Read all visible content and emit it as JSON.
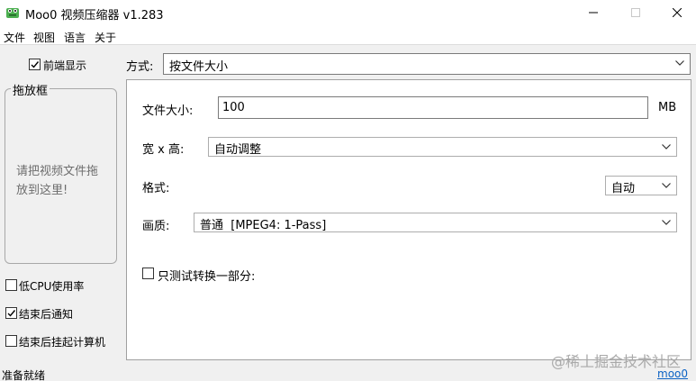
{
  "window": {
    "title": "Moo0 视频压缩器 v1.283",
    "icon": "frog-icon"
  },
  "menu": {
    "items": [
      "文件",
      "视图",
      "语言",
      "关于"
    ]
  },
  "sidebar": {
    "front_display": {
      "label": "前端显示",
      "checked": true
    },
    "drop_frame": {
      "title": "拖放框",
      "hint": "请把视频文件拖放到这里!"
    },
    "options": [
      {
        "label": "低CPU使用率",
        "checked": false
      },
      {
        "label": "结束后通知",
        "checked": true
      },
      {
        "label": "结束后挂起计算机",
        "checked": false
      }
    ]
  },
  "method": {
    "label": "方式:",
    "value": "按文件大小"
  },
  "panel": {
    "file_size": {
      "label": "文件大小:",
      "value": "100",
      "unit": "MB"
    },
    "resolution": {
      "label": "宽 x 高:",
      "value": "自动调整"
    },
    "format": {
      "label": "格式:",
      "value": "自动"
    },
    "quality": {
      "label": "画质:",
      "value": "普通  [MPEG4: 1-Pass]"
    },
    "test_partial": {
      "label": "只测试转换一部分:",
      "checked": false
    }
  },
  "status": {
    "text": "准备就绪",
    "link": "moo0"
  },
  "watermark": "@稀土掘金技术社区"
}
